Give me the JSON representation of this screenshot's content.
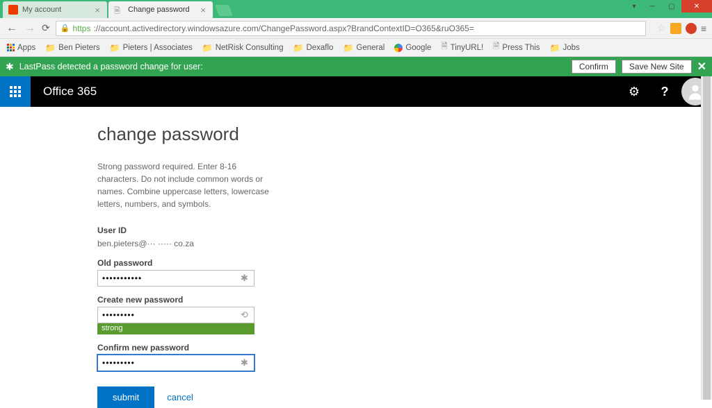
{
  "window": {
    "tabs": [
      {
        "title": "My account",
        "active": false
      },
      {
        "title": "Change password",
        "active": true
      }
    ]
  },
  "addressbar": {
    "protocol": "https",
    "url_display": "://account.activedirectory.windowsazure.com/ChangePassword.aspx?BrandContextID=O365&ruO365="
  },
  "bookmarks": {
    "apps": "Apps",
    "items": [
      "Ben Pieters",
      "Pieters | Associates",
      "NetRisk Consulting",
      "Dexaflo",
      "General",
      "Google",
      "TinyURL!",
      "Press This",
      "Jobs"
    ]
  },
  "lastpass": {
    "message": "LastPass detected a password change for user:",
    "confirm": "Confirm",
    "save": "Save New Site"
  },
  "o365": {
    "product": "Office 365"
  },
  "page": {
    "heading": "change password",
    "help": "Strong password required. Enter 8-16 characters. Do not include common words or names. Combine uppercase letters, lowercase letters, numbers, and symbols.",
    "userid_label": "User ID",
    "userid_value": "ben.pieters@··· ····· co.za",
    "old_pw_label": "Old password",
    "old_pw_value": "•••••••••••",
    "new_pw_label": "Create new password",
    "new_pw_value": "•••••••••",
    "strength": "strong",
    "confirm_pw_label": "Confirm new password",
    "confirm_pw_value": "•••••••••",
    "submit": "submit",
    "cancel": "cancel"
  }
}
